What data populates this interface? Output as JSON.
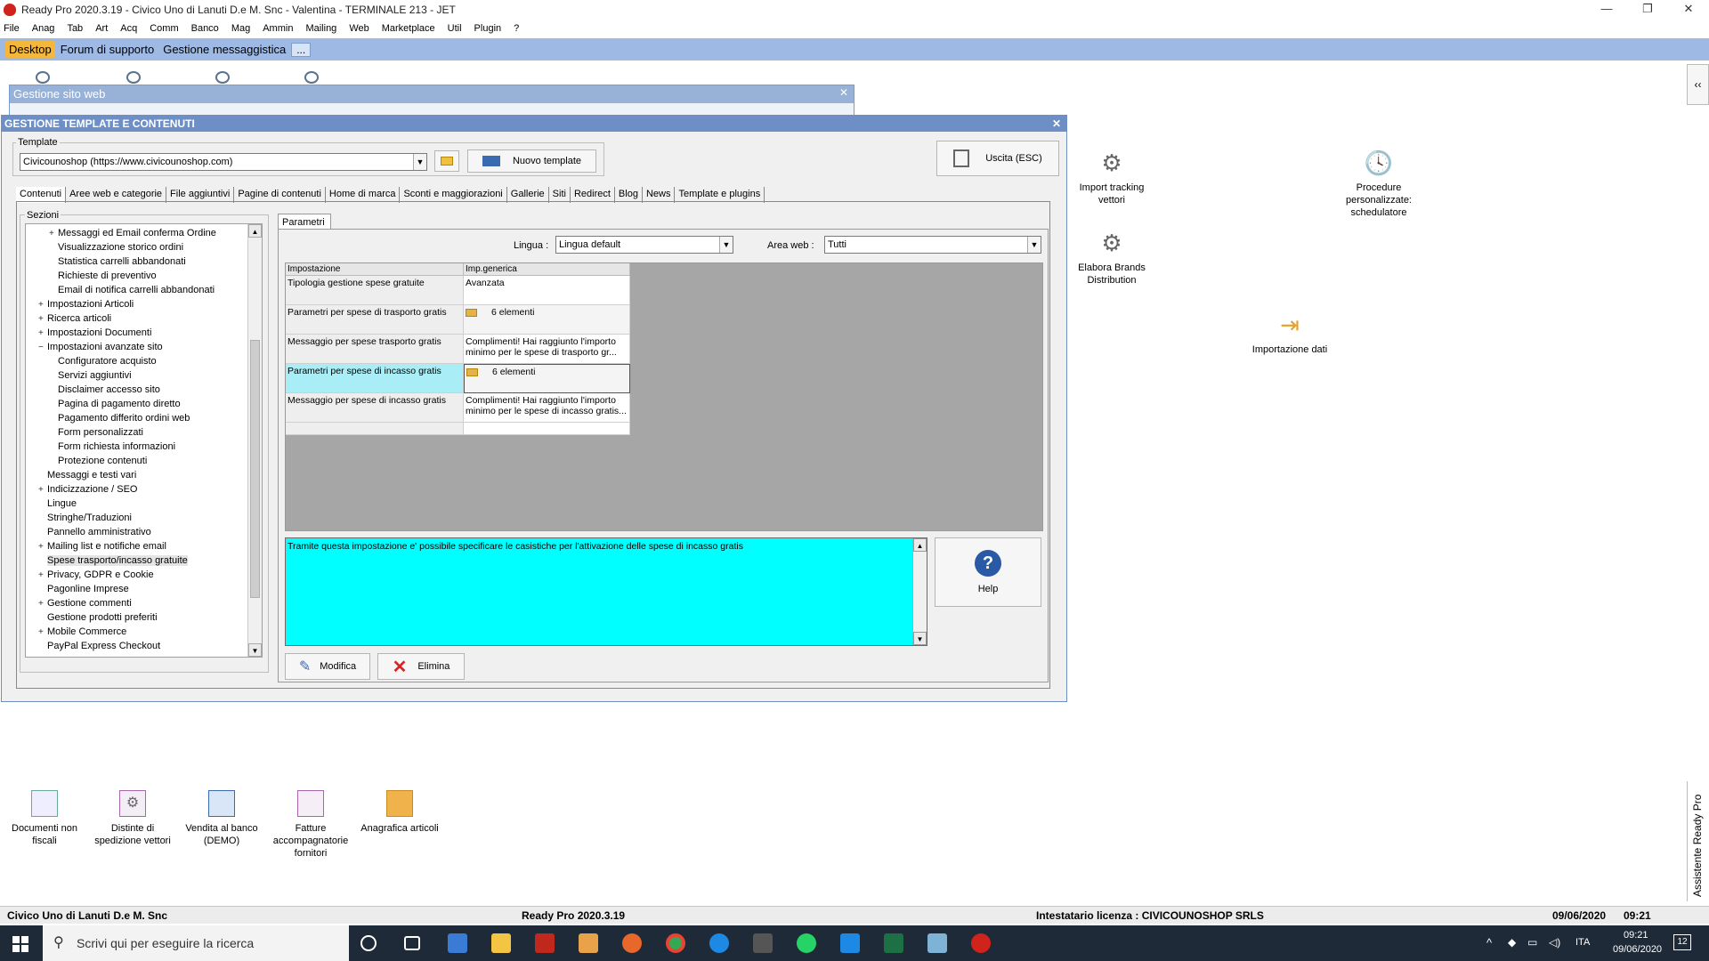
{
  "window": {
    "title": "Ready Pro 2020.3.19 - Civico Uno di Lanuti D.e M. Snc - Valentina - TERMINALE 213 - JET",
    "controls": [
      "—",
      "❐",
      "✕"
    ]
  },
  "menu": [
    "File",
    "Anag",
    "Tab",
    "Art",
    "Acq",
    "Comm",
    "Banco",
    "Mag",
    "Ammin",
    "Mailing",
    "Web",
    "Marketplace",
    "Util",
    "Plugin",
    "?"
  ],
  "top_tabs": [
    "Desktop",
    "Forum di supporto",
    "Gestione messaggistica",
    "..."
  ],
  "bg_window": {
    "title": "Gestione sito web",
    "close": "✕"
  },
  "dialog": {
    "title": "GESTIONE TEMPLATE E CONTENUTI",
    "close": "✕",
    "template_label": "Template",
    "template_value": "Civicounoshop (https://www.civicounoshop.com)",
    "new_template": "Nuovo template",
    "exit": "Uscita (ESC)",
    "tabs": [
      "Contenuti",
      "Aree web e categorie",
      "File aggiuntivi",
      "Pagine di contenuti",
      "Home di marca",
      "Sconti e maggiorazioni",
      "Gallerie",
      "Siti",
      "Redirect",
      "Blog",
      "News",
      "Template e plugins"
    ],
    "sections_label": "Sezioni",
    "params_tab": "Parametri",
    "lingua_label": "Lingua :",
    "lingua_value": "Lingua default",
    "area_label": "Area web :",
    "area_value": "Tutti",
    "grid_headers": [
      "Impostazione",
      "Imp.generica"
    ],
    "grid_rows": [
      {
        "name": "Tipologia gestione spese gratuite",
        "value": "Avanzata"
      },
      {
        "name": "Parametri per spese di trasporto gratis",
        "value": "6 elementi"
      },
      {
        "name": "Messaggio per spese trasporto gratis",
        "value": "Complimenti! Hai raggiunto l'importo minimo per le spese di trasporto gr..."
      },
      {
        "name": "Parametri per spese di incasso gratis",
        "value": "6 elementi"
      },
      {
        "name": "Messaggio per spese di incasso gratis",
        "value": "Complimenti! Hai raggiunto l'importo minimo per le spese di incasso gratis..."
      }
    ],
    "info_text": "Tramite questa impostazione e' possibile specificare le casistiche per l'attivazione delle spese di incasso gratis",
    "help": "Help",
    "modify": "Modifica",
    "delete": "Elimina"
  },
  "tree": [
    {
      "label": "Messaggi ed Email conferma Ordine",
      "level": 2,
      "exp": "+"
    },
    {
      "label": "Visualizzazione storico ordini",
      "level": 2,
      "exp": ""
    },
    {
      "label": "Statistica carrelli abbandonati",
      "level": 2,
      "exp": ""
    },
    {
      "label": "Richieste di preventivo",
      "level": 2,
      "exp": ""
    },
    {
      "label": "Email di notifica carrelli abbandonati",
      "level": 2,
      "exp": ""
    },
    {
      "label": "Impostazioni Articoli",
      "level": 1,
      "exp": "+"
    },
    {
      "label": "Ricerca articoli",
      "level": 1,
      "exp": "+"
    },
    {
      "label": "Impostazioni Documenti",
      "level": 1,
      "exp": "+"
    },
    {
      "label": "Impostazioni avanzate sito",
      "level": 1,
      "exp": "−"
    },
    {
      "label": "Configuratore acquisto",
      "level": 2,
      "exp": ""
    },
    {
      "label": "Servizi aggiuntivi",
      "level": 2,
      "exp": ""
    },
    {
      "label": "Disclaimer accesso sito",
      "level": 2,
      "exp": ""
    },
    {
      "label": "Pagina di pagamento diretto",
      "level": 2,
      "exp": ""
    },
    {
      "label": "Pagamento differito ordini web",
      "level": 2,
      "exp": ""
    },
    {
      "label": "Form personalizzati",
      "level": 2,
      "exp": ""
    },
    {
      "label": "Form richiesta informazioni",
      "level": 2,
      "exp": ""
    },
    {
      "label": "Protezione contenuti",
      "level": 2,
      "exp": ""
    },
    {
      "label": "Messaggi e testi vari",
      "level": 1,
      "exp": ""
    },
    {
      "label": "Indicizzazione / SEO",
      "level": 1,
      "exp": "+"
    },
    {
      "label": "Lingue",
      "level": 1,
      "exp": ""
    },
    {
      "label": "Stringhe/Traduzioni",
      "level": 1,
      "exp": ""
    },
    {
      "label": "Pannello amministrativo",
      "level": 1,
      "exp": ""
    },
    {
      "label": "Mailing list e notifiche email",
      "level": 1,
      "exp": "+"
    },
    {
      "label": "Spese trasporto/incasso gratuite",
      "level": 1,
      "exp": "",
      "selected": true
    },
    {
      "label": "Privacy, GDPR e Cookie",
      "level": 1,
      "exp": "+"
    },
    {
      "label": "Pagonline Imprese",
      "level": 1,
      "exp": ""
    },
    {
      "label": "Gestione commenti",
      "level": 1,
      "exp": "+"
    },
    {
      "label": "Gestione prodotti preferiti",
      "level": 1,
      "exp": ""
    },
    {
      "label": "Mobile Commerce",
      "level": 1,
      "exp": "+"
    },
    {
      "label": "PayPal Express Checkout",
      "level": 1,
      "exp": ""
    }
  ],
  "desktop_icons_right": [
    {
      "label": "Import tracking vettori",
      "icon": "gear-icon"
    },
    {
      "label": "Procedure personalizzate: schedulatore",
      "icon": "clock-icon"
    },
    {
      "label": "Elabora Brands Distribution",
      "icon": "gear-icon"
    },
    {
      "label": "Importazione dati",
      "icon": "import-icon"
    }
  ],
  "desktop_icons_bottom": [
    {
      "label": "Documenti non fiscali",
      "icon": "document-icon"
    },
    {
      "label": "Distinte di spedizione vettori",
      "icon": "settings-doc-icon"
    },
    {
      "label": "Vendita al banco (DEMO)",
      "icon": "register-icon"
    },
    {
      "label": "Fatture accompagnatorie fornitori",
      "icon": "invoice-icon"
    },
    {
      "label": "Anagrafica articoli",
      "icon": "box-icon"
    }
  ],
  "assistant": "Assistente Ready Pro",
  "status": {
    "company": "Civico Uno di Lanuti D.e M. Snc",
    "version": "Ready Pro 2020.3.19",
    "license": "Intestatario licenza : CIVICOUNOSHOP SRLS",
    "date": "09/06/2020",
    "time": "09:21"
  },
  "taskbar": {
    "search_placeholder": "Scrivi qui per eseguire la ricerca",
    "lang": "ITA",
    "clock_time": "09:21",
    "clock_date": "09/06/2020",
    "notifications": "12"
  }
}
